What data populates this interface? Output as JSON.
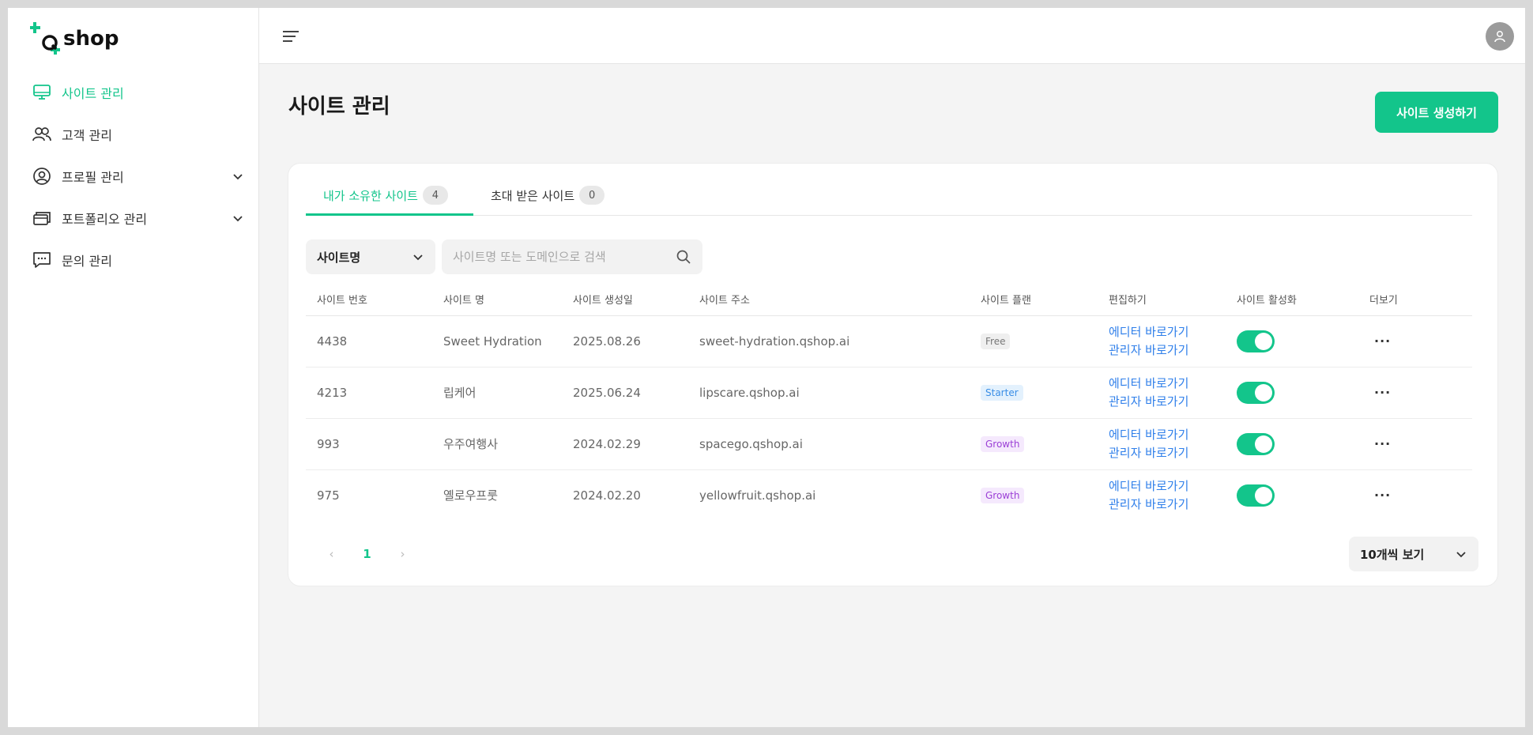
{
  "brand": {
    "logo_text": "shop",
    "logo_mark": "Q",
    "accent": "#13c58b"
  },
  "sidebar": {
    "items": [
      {
        "label": "사이트 관리",
        "icon": "monitor-icon",
        "active": true,
        "expandable": false
      },
      {
        "label": "고객 관리",
        "icon": "users-icon",
        "active": false,
        "expandable": false
      },
      {
        "label": "프로필 관리",
        "icon": "user-circle-icon",
        "active": false,
        "expandable": true
      },
      {
        "label": "포트폴리오 관리",
        "icon": "cards-icon",
        "active": false,
        "expandable": true
      },
      {
        "label": "문의 관리",
        "icon": "chat-icon",
        "active": false,
        "expandable": false
      }
    ]
  },
  "header": {
    "menu_icon": "hamburger-icon",
    "avatar_icon": "user-avatar-icon"
  },
  "main": {
    "title": "사이트 관리",
    "create_button": "사이트 생성하기",
    "tabs": [
      {
        "label": "내가 소유한 사이트",
        "count": "4",
        "active": true
      },
      {
        "label": "초대 받은 사이트",
        "count": "0",
        "active": false
      }
    ],
    "filter": {
      "selected": "사이트명"
    },
    "search": {
      "placeholder": "사이트명 또는 도메인으로 검색",
      "value": ""
    },
    "table": {
      "columns": [
        "사이트 번호",
        "사이트 명",
        "사이트 생성일",
        "사이트 주소",
        "사이트 플랜",
        "편집하기",
        "사이트 활성화",
        "더보기"
      ],
      "edit_links": {
        "editor": "에디터 바로가기",
        "admin": "관리자 바로가기"
      },
      "more_label": "···",
      "rows": [
        {
          "id": "4438",
          "name": "Sweet Hydration",
          "created": "2025.08.26",
          "address": "sweet-hydration.qshop.ai",
          "plan": "Free",
          "active": true
        },
        {
          "id": "4213",
          "name": "립케어",
          "created": "2025.06.24",
          "address": "lipscare.qshop.ai",
          "plan": "Starter",
          "active": true
        },
        {
          "id": "993",
          "name": "우주여행사",
          "created": "2024.02.29",
          "address": "spacego.qshop.ai",
          "plan": "Growth",
          "active": true
        },
        {
          "id": "975",
          "name": "옐로우프룻",
          "created": "2024.02.20",
          "address": "yellowfruit.qshop.ai",
          "plan": "Growth",
          "active": true
        }
      ]
    },
    "plan_colors": {
      "Free": {
        "bg": "#efefef",
        "fg": "#777777"
      },
      "Starter": {
        "bg": "#e3f1fd",
        "fg": "#3a8ee6"
      },
      "Growth": {
        "bg": "#f5e9fd",
        "fg": "#9b3fd6"
      }
    },
    "pagination": {
      "prev": "‹",
      "current": "1",
      "next": "›"
    },
    "page_size": "10개씩 보기"
  }
}
